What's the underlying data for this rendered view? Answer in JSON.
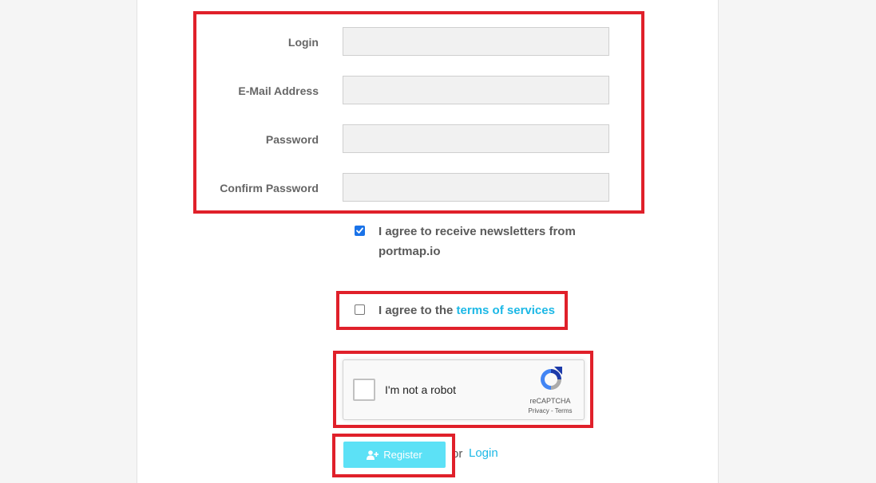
{
  "form": {
    "fields": [
      {
        "label": "Login",
        "value": ""
      },
      {
        "label": "E-Mail Address",
        "value": ""
      },
      {
        "label": "Password",
        "value": ""
      },
      {
        "label": "Confirm Password",
        "value": ""
      }
    ],
    "newsletter": {
      "checked": true,
      "line1": "I agree to receive newsletters from",
      "line2": "portmap.io"
    },
    "terms": {
      "checked": false,
      "prefix": "I agree to the ",
      "link": "terms of services"
    },
    "recaptcha": {
      "label": "I'm not a robot",
      "brand": "reCAPTCHA",
      "terms": "Privacy - Terms",
      "icon": "recaptcha-logo"
    },
    "register_button": {
      "label": "Register",
      "icon": "user-plus-icon"
    },
    "or_text": "or",
    "login_link": "Login"
  },
  "colors": {
    "highlight": "#e0202a",
    "link": "#1cb8e6",
    "register_bg": "#5ce1f6",
    "checkbox_checked": "#1a73e8"
  }
}
